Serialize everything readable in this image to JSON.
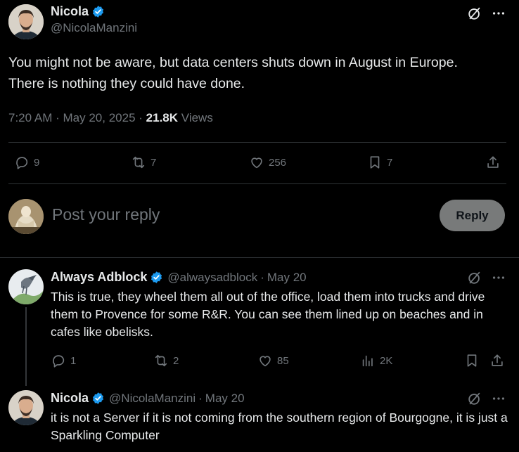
{
  "main_tweet": {
    "author_name": "Nicola",
    "author_handle": "@NicolaManzini",
    "text": "You might not be aware, but data centers shuts down in August in Europe. There is nothing they could have done.",
    "time": "7:20 AM",
    "sep1": "·",
    "date": "May 20, 2025",
    "sep2": "·",
    "views_count": "21.8K",
    "views_label": "Views",
    "replies": "9",
    "retweets": "7",
    "likes": "256",
    "bookmarks": "7"
  },
  "composer": {
    "placeholder": "Post your reply",
    "reply_label": "Reply"
  },
  "reply1": {
    "author_name": "Always Adblock",
    "author_handle": "@alwaysadblock",
    "sep": "·",
    "date": "May 20",
    "text": "This is true, they wheel them all out of the office, load them into trucks and drive them to Provence for some R&R. You can see them lined up on beaches and in cafes like obelisks.",
    "replies": "1",
    "retweets": "2",
    "likes": "85",
    "views": "2K"
  },
  "reply2": {
    "author_name": "Nicola",
    "author_handle": "@NicolaManzini",
    "sep": "·",
    "date": "May 20",
    "text": "it is not a Server if it is not coming from the southern region of Bourgogne, it is just a Sparkling Computer"
  },
  "colors": {
    "background": "#000000",
    "text": "#e7e9ea",
    "muted": "#71767b",
    "verified": "#1d9bf0",
    "divider": "#2f3336"
  }
}
